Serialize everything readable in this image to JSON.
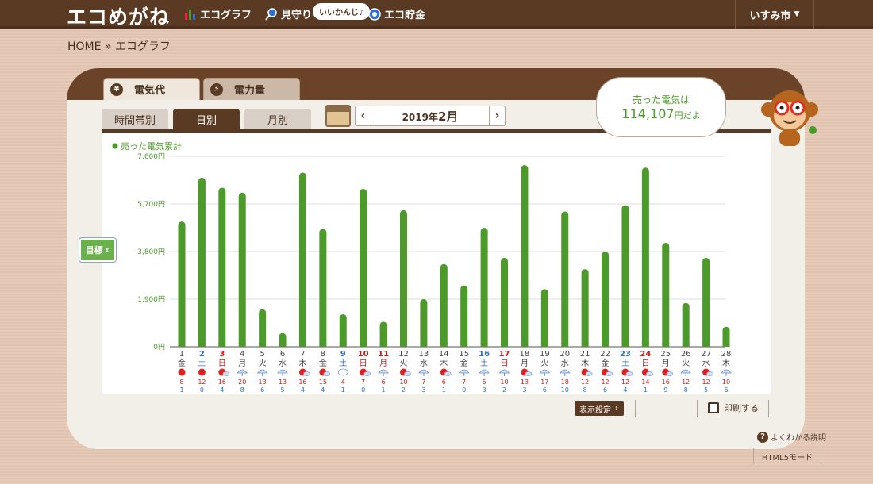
{
  "header": {
    "logo": "エコめがね",
    "nav": [
      {
        "label": "エコグラフ",
        "icon": "bar-chart-icon"
      },
      {
        "label": "見守り",
        "icon": "magnifier-icon"
      },
      {
        "label": "エコ貯金",
        "icon": "piggy-coin-icon"
      }
    ],
    "bubble": "いいかんじ♪",
    "city": "いすみ市"
  },
  "breadcrumb": "HOME » エコグラフ",
  "tabs_top": [
    {
      "label": "電気代",
      "icon": "yen-coin-icon",
      "active": true
    },
    {
      "label": "電力量",
      "icon": "lightning-icon",
      "active": false
    }
  ],
  "tabs_mode": [
    {
      "label": "時間帯別",
      "active": false
    },
    {
      "label": "日別",
      "active": true
    },
    {
      "label": "月別",
      "active": false
    }
  ],
  "month_picker": {
    "year_label": "2019年",
    "month_label": "2月",
    "prev": "‹",
    "next": "›"
  },
  "speech": {
    "line1": "売った電気は",
    "amount": "114,107",
    "unit": "円だよ"
  },
  "target_button": "目標",
  "settings_button": "表示設定",
  "print_button": "印刷する",
  "help_link": "よくわかる説明",
  "html5_link": "HTML5モード",
  "colors": {
    "bar": "#4c9a2a",
    "weekday": "#444444",
    "saturday": "#2f6fd6",
    "sunday_holiday": "#d01818",
    "high_temp": "#d01818",
    "low_temp": "#2f6fd6"
  },
  "chart_data": {
    "type": "bar",
    "title": "",
    "legend": "売った電気累計",
    "ylabel": "",
    "ylim": [
      0,
      7600
    ],
    "yticks": [
      "0円",
      "1,900円",
      "3,800円",
      "5,700円",
      "7,600円"
    ],
    "ytick_values": [
      0,
      1900,
      3800,
      5700,
      7600
    ],
    "grid": true,
    "days": [
      {
        "d": "1",
        "w": "金",
        "kind": "weekday",
        "v": 5000,
        "weather": "sun",
        "hi": "8",
        "lo": "1"
      },
      {
        "d": "2",
        "w": "土",
        "kind": "saturday",
        "v": 6750,
        "weather": "sun",
        "hi": "12",
        "lo": "0"
      },
      {
        "d": "3",
        "w": "日",
        "kind": "sunday",
        "v": 6350,
        "weather": "sun-cloud",
        "hi": "16",
        "lo": "4"
      },
      {
        "d": "4",
        "w": "月",
        "kind": "weekday",
        "v": 6150,
        "weather": "cloud-sun",
        "hi": "20",
        "lo": "8"
      },
      {
        "d": "5",
        "w": "火",
        "kind": "weekday",
        "v": 1500,
        "weather": "cloud-rain",
        "hi": "13",
        "lo": "6"
      },
      {
        "d": "6",
        "w": "水",
        "kind": "weekday",
        "v": 550,
        "weather": "rain",
        "hi": "13",
        "lo": "5"
      },
      {
        "d": "7",
        "w": "木",
        "kind": "weekday",
        "v": 6950,
        "weather": "sun-cloud",
        "hi": "16",
        "lo": "4"
      },
      {
        "d": "8",
        "w": "金",
        "kind": "weekday",
        "v": 4700,
        "weather": "sun-cloud",
        "hi": "15",
        "lo": "4"
      },
      {
        "d": "9",
        "w": "土",
        "kind": "saturday",
        "v": 1300,
        "weather": "snow",
        "hi": "4",
        "lo": "1"
      },
      {
        "d": "10",
        "w": "日",
        "kind": "sunday",
        "v": 6300,
        "weather": "sun-cloud",
        "hi": "7",
        "lo": "0"
      },
      {
        "d": "11",
        "w": "月",
        "kind": "holiday",
        "v": 1000,
        "weather": "cloud-rain",
        "hi": "6",
        "lo": "1"
      },
      {
        "d": "12",
        "w": "火",
        "kind": "weekday",
        "v": 5450,
        "weather": "sun-rain",
        "hi": "10",
        "lo": "2"
      },
      {
        "d": "13",
        "w": "水",
        "kind": "weekday",
        "v": 1900,
        "weather": "rain",
        "hi": "7",
        "lo": "3"
      },
      {
        "d": "14",
        "w": "木",
        "kind": "weekday",
        "v": 3300,
        "weather": "sun-cloud",
        "hi": "6",
        "lo": "1"
      },
      {
        "d": "15",
        "w": "金",
        "kind": "weekday",
        "v": 2450,
        "weather": "rain",
        "hi": "7",
        "lo": "0"
      },
      {
        "d": "16",
        "w": "土",
        "kind": "saturday",
        "v": 4750,
        "weather": "rain",
        "hi": "5",
        "lo": "3"
      },
      {
        "d": "17",
        "w": "日",
        "kind": "sunday",
        "v": 3550,
        "weather": "cloud-sun",
        "hi": "10",
        "lo": "2"
      },
      {
        "d": "18",
        "w": "月",
        "kind": "weekday",
        "v": 7250,
        "weather": "sun-cloud",
        "hi": "13",
        "lo": "3"
      },
      {
        "d": "19",
        "w": "火",
        "kind": "weekday",
        "v": 2300,
        "weather": "cloud-rain",
        "hi": "17",
        "lo": "6"
      },
      {
        "d": "20",
        "w": "水",
        "kind": "weekday",
        "v": 5400,
        "weather": "rain",
        "hi": "18",
        "lo": "10"
      },
      {
        "d": "21",
        "w": "木",
        "kind": "weekday",
        "v": 3100,
        "weather": "sun-cloud",
        "hi": "12",
        "lo": "8"
      },
      {
        "d": "22",
        "w": "金",
        "kind": "weekday",
        "v": 3800,
        "weather": "sun-cloud",
        "hi": "12",
        "lo": "6"
      },
      {
        "d": "23",
        "w": "土",
        "kind": "saturday",
        "v": 5650,
        "weather": "sun-cloud",
        "hi": "12",
        "lo": "4"
      },
      {
        "d": "24",
        "w": "日",
        "kind": "sunday",
        "v": 7150,
        "weather": "sun-cloud",
        "hi": "14",
        "lo": "1"
      },
      {
        "d": "25",
        "w": "月",
        "kind": "weekday",
        "v": 4150,
        "weather": "sun-cloud",
        "hi": "16",
        "lo": "9"
      },
      {
        "d": "26",
        "w": "火",
        "kind": "weekday",
        "v": 1750,
        "weather": "cloud-rain",
        "hi": "12",
        "lo": "8"
      },
      {
        "d": "27",
        "w": "水",
        "kind": "weekday",
        "v": 3550,
        "weather": "sun-cloud",
        "hi": "12",
        "lo": "5"
      },
      {
        "d": "28",
        "w": "木",
        "kind": "weekday",
        "v": 800,
        "weather": "rain",
        "hi": "10",
        "lo": "6"
      }
    ]
  }
}
